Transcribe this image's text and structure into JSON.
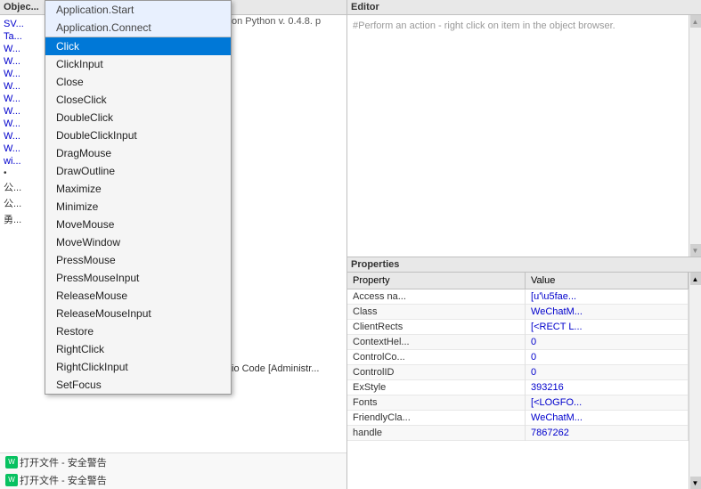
{
  "leftPanel": {
    "header": "Objec...",
    "treeItems": [
      {
        "label": "SV...",
        "color": "blue"
      },
      {
        "label": "Ta...",
        "color": "blue"
      },
      {
        "label": "W...",
        "color": "blue"
      },
      {
        "label": "W...",
        "color": "blue"
      },
      {
        "label": "W...",
        "color": "blue"
      },
      {
        "label": "W...",
        "color": "blue"
      },
      {
        "label": "W...",
        "color": "blue"
      },
      {
        "label": "W...",
        "color": "blue"
      },
      {
        "label": "W...",
        "color": "blue"
      },
      {
        "label": "W...",
        "color": "blue"
      },
      {
        "label": "W...",
        "color": "blue"
      },
      {
        "label": "wi...",
        "color": "blue"
      },
      {
        "label": "•",
        "color": "black"
      },
      {
        "label": "公...",
        "color": "black"
      },
      {
        "label": "公...",
        "color": "black"
      },
      {
        "label": "勇...",
        "color": "black"
      }
    ],
    "bottomItems": [
      {
        "label": "打开文件 - 安全警告",
        "icon": "weixin"
      },
      {
        "label": "打开文件 - 安全警告",
        "icon": "weixin"
      }
    ],
    "middleText": "on Python v. 0.4.8. p",
    "codeText": "io Code [Administr..."
  },
  "contextMenu": {
    "topItems": [
      {
        "label": "Application.Start"
      },
      {
        "label": "Application.Connect"
      }
    ],
    "items": [
      {
        "label": "Click",
        "highlighted": true
      },
      {
        "label": "ClickInput"
      },
      {
        "label": "Close"
      },
      {
        "label": "CloseClick"
      },
      {
        "label": "DoubleClick"
      },
      {
        "label": "DoubleClickInput"
      },
      {
        "label": "DragMouse"
      },
      {
        "label": "DrawOutline"
      },
      {
        "label": "Maximize"
      },
      {
        "label": "Minimize"
      },
      {
        "label": "MoveMouse"
      },
      {
        "label": "MoveWindow"
      },
      {
        "label": "PressMouse"
      },
      {
        "label": "PressMouseInput"
      },
      {
        "label": "ReleaseMouse"
      },
      {
        "label": "ReleaseMouseInput"
      },
      {
        "label": "Restore"
      },
      {
        "label": "RightClick"
      },
      {
        "label": "RightClickInput"
      },
      {
        "label": "SetFocus"
      }
    ]
  },
  "editor": {
    "header": "Editor",
    "placeholder": "#Perform an action - right click on item in the object browser."
  },
  "properties": {
    "header": "Properties",
    "columns": [
      "Property",
      "Value"
    ],
    "rows": [
      {
        "property": "Access na...",
        "value": "[u'\\u5fae..."
      },
      {
        "property": "Class",
        "value": "WeChatM..."
      },
      {
        "property": "ClientRects",
        "value": "[<RECT L..."
      },
      {
        "property": "ContextHel...",
        "value": "0"
      },
      {
        "property": "ControlCo...",
        "value": "0"
      },
      {
        "property": "ControlID",
        "value": "0"
      },
      {
        "property": "ExStyle",
        "value": "393216"
      },
      {
        "property": "Fonts",
        "value": "[<LOGFO..."
      },
      {
        "property": "FriendlyCla...",
        "value": "WeChatM..."
      },
      {
        "property": "handle",
        "value": "7867262"
      }
    ]
  }
}
